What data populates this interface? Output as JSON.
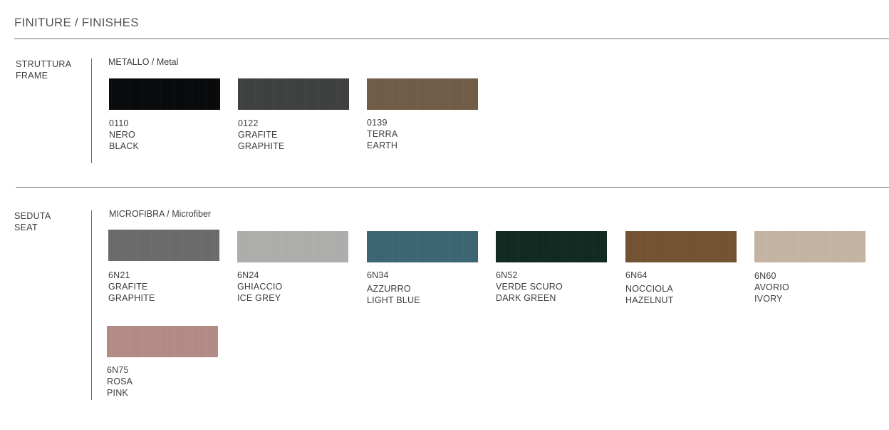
{
  "page": {
    "title": "FINITURE / FINISHES"
  },
  "frame": {
    "label_it": "STRUTTURA",
    "label_en": "FRAME",
    "material": "METALLO / Metal",
    "swatches": [
      {
        "code": "0110",
        "name_it": "NERO",
        "name_en": "BLACK",
        "color": "#07080a"
      },
      {
        "code": "0122",
        "name_it": "GRAFITE",
        "name_en": "GRAPHITE",
        "color": "#3e403f"
      },
      {
        "code": "0139",
        "name_it": "TERRA",
        "name_en": "EARTH",
        "color": "#715c46"
      }
    ]
  },
  "seat": {
    "label_it": "SEDUTA",
    "label_en": "SEAT",
    "material": "MICROFIBRA / Microfiber",
    "swatches": [
      {
        "code": "6N21",
        "name_it": "GRAFITE",
        "name_en": "GRAPHITE",
        "color": "#6b6b6b"
      },
      {
        "code": "6N24",
        "name_it": "GHIACCIO",
        "name_en": "ICE GREY",
        "color": "#aeaeac"
      },
      {
        "code": "6N34",
        "name_it": "AZZURRO",
        "name_en": "LIGHT BLUE",
        "color": "#3b6673"
      },
      {
        "code": "6N52",
        "name_it": "VERDE SCURO",
        "name_en": "DARK GREEN",
        "color": "#0f2920"
      },
      {
        "code": "6N64",
        "name_it": "NOCCIOLA",
        "name_en": "HAZELNUT",
        "color": "#735331"
      },
      {
        "code": "6N60",
        "name_it": "AVORIO",
        "name_en": "IVORY",
        "color": "#c7b5a2"
      },
      {
        "code": "6N75",
        "name_it": "ROSA",
        "name_en": "PINK",
        "color": "#b48c85"
      }
    ]
  }
}
